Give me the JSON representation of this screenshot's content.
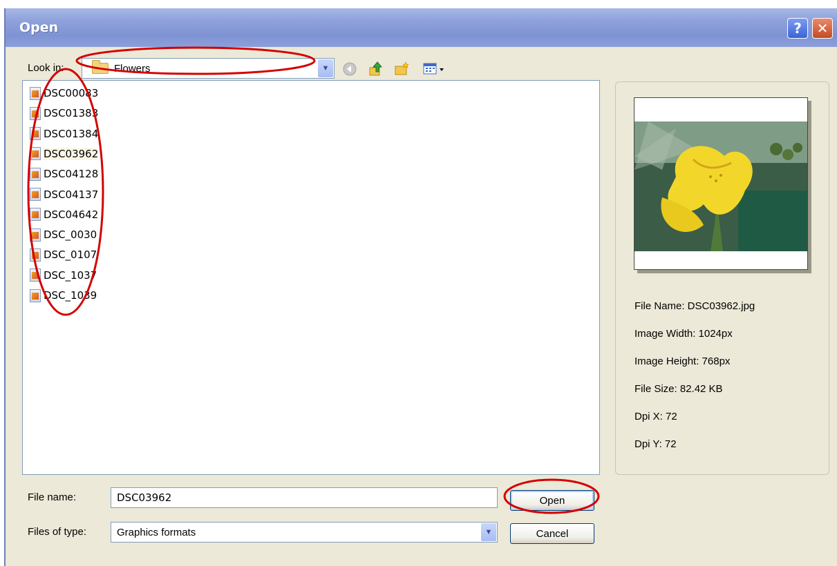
{
  "window": {
    "title": "Open",
    "help_glyph": "?",
    "close_glyph": "✕"
  },
  "look_in": {
    "label": "Look in:",
    "value": "Flowers"
  },
  "toolbar": {
    "icons": [
      "back-icon",
      "up-folder-icon",
      "new-folder-icon",
      "view-menu-icon"
    ]
  },
  "files": [
    {
      "name": "DSC00083"
    },
    {
      "name": "DSC01383"
    },
    {
      "name": "DSC01384"
    },
    {
      "name": "DSC03962",
      "selected": true
    },
    {
      "name": "DSC04128"
    },
    {
      "name": "DSC04137"
    },
    {
      "name": "DSC04642"
    },
    {
      "name": "DSC_0030"
    },
    {
      "name": "DSC_0107"
    },
    {
      "name": "DSC_1037"
    },
    {
      "name": "DSC_1039"
    }
  ],
  "preview": {
    "file_name": "File Name: DSC03962.jpg",
    "image_width": "Image Width: 1024px",
    "image_height": "Image Height: 768px",
    "file_size": "File Size: 82.42 KB",
    "dpi_x": "Dpi X: 72",
    "dpi_y": "Dpi Y: 72"
  },
  "form": {
    "file_name_label": "File name:",
    "file_name_value": "DSC03962",
    "file_type_label": "Files of type:",
    "file_type_value": "Graphics formats"
  },
  "buttons": {
    "open": "Open",
    "cancel": "Cancel"
  },
  "annotations": {
    "highlight_color": "#d40000"
  }
}
